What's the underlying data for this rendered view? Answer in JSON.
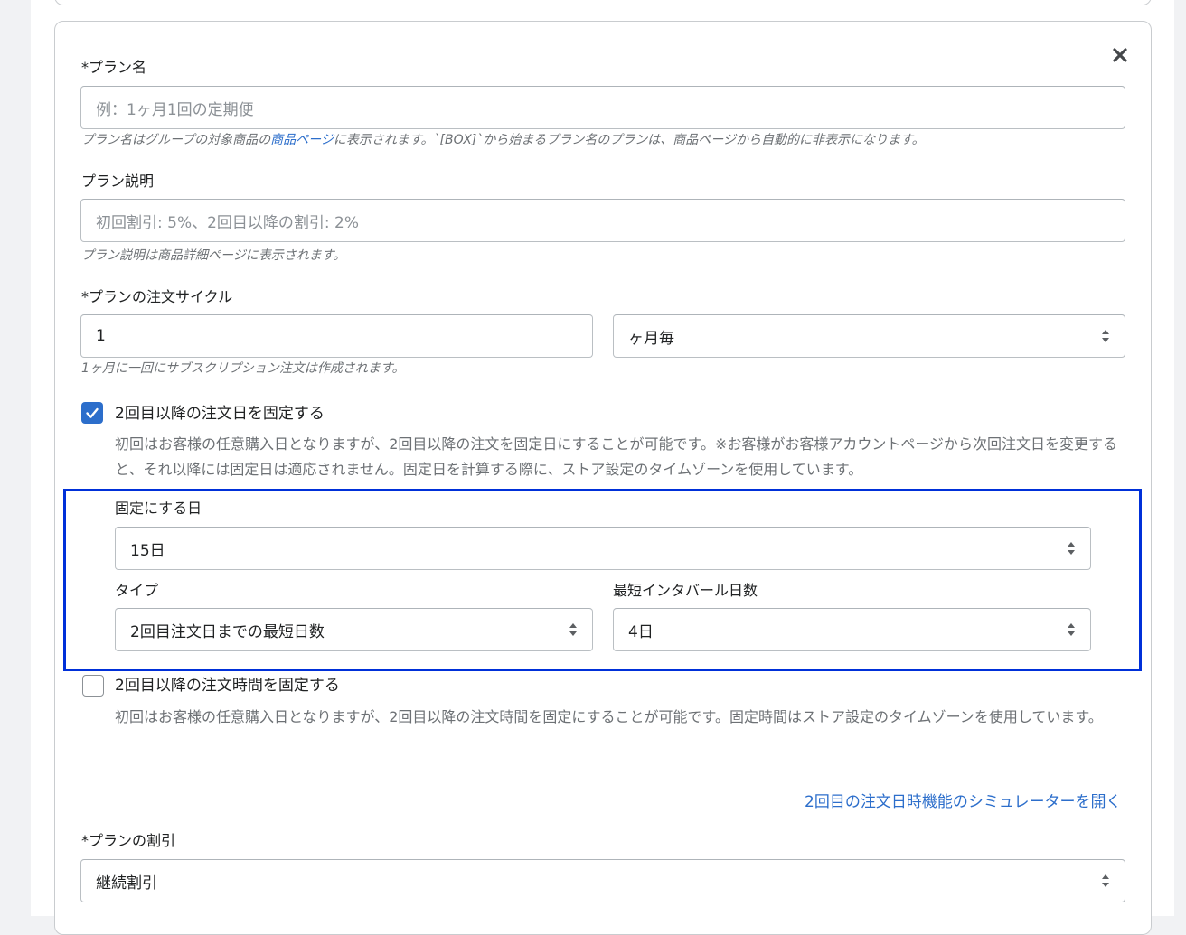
{
  "plan_name": {
    "label": "*プラン名",
    "placeholder": "例：1ヶ月1回の定期便",
    "help_before": "プラン名はグループの対象商品の",
    "help_link": "商品ページ",
    "help_after": "に表示されます。`[BOX]`から始まるプラン名のプランは、商品ページから自動的に非表示になります。"
  },
  "plan_description": {
    "label": "プラン説明",
    "placeholder": "初回割引: 5%、2回目以降の割引: 2%",
    "help": "プラン説明は商品詳細ページに表示されます。"
  },
  "order_cycle": {
    "label": "*プランの注文サイクル",
    "value": "1",
    "unit": "ヶ月毎",
    "help": "1ヶ月に一回にサブスクリプション注文は作成されます。"
  },
  "fix_order_date": {
    "checked": true,
    "label": "2回目以降の注文日を固定する",
    "description": "初回はお客様の任意購入日となりますが、2回目以降の注文を固定日にすることが可能です。※お客様がお客様アカウントページから次回注文日を変更すると、それ以降には固定日は適応されません。固定日を計算する際に、ストア設定のタイムゾーンを使用しています。"
  },
  "fixed_day": {
    "label": "固定にする日",
    "value": "15日"
  },
  "type": {
    "label": "タイプ",
    "value": "2回目注文日までの最短日数"
  },
  "min_interval": {
    "label": "最短インタバール日数",
    "value": "4日"
  },
  "fix_order_time": {
    "checked": false,
    "label": "2回目以降の注文時間を固定する",
    "description": "初回はお客様の任意購入日となりますが、2回目以降の注文時間を固定にすることが可能です。固定時間はストア設定のタイムゾーンを使用しています。"
  },
  "simulator_link": "2回目の注文日時機能のシミュレーターを開く",
  "plan_discount": {
    "label": "*プランの割引",
    "value": "継続割引"
  },
  "colors": {
    "accent": "#2c6ecb",
    "highlight_border": "#0030d9",
    "muted_text": "#6d7175"
  },
  "icons": {
    "close": "close-icon",
    "select": "select-arrows-icon",
    "check": "check-icon"
  }
}
